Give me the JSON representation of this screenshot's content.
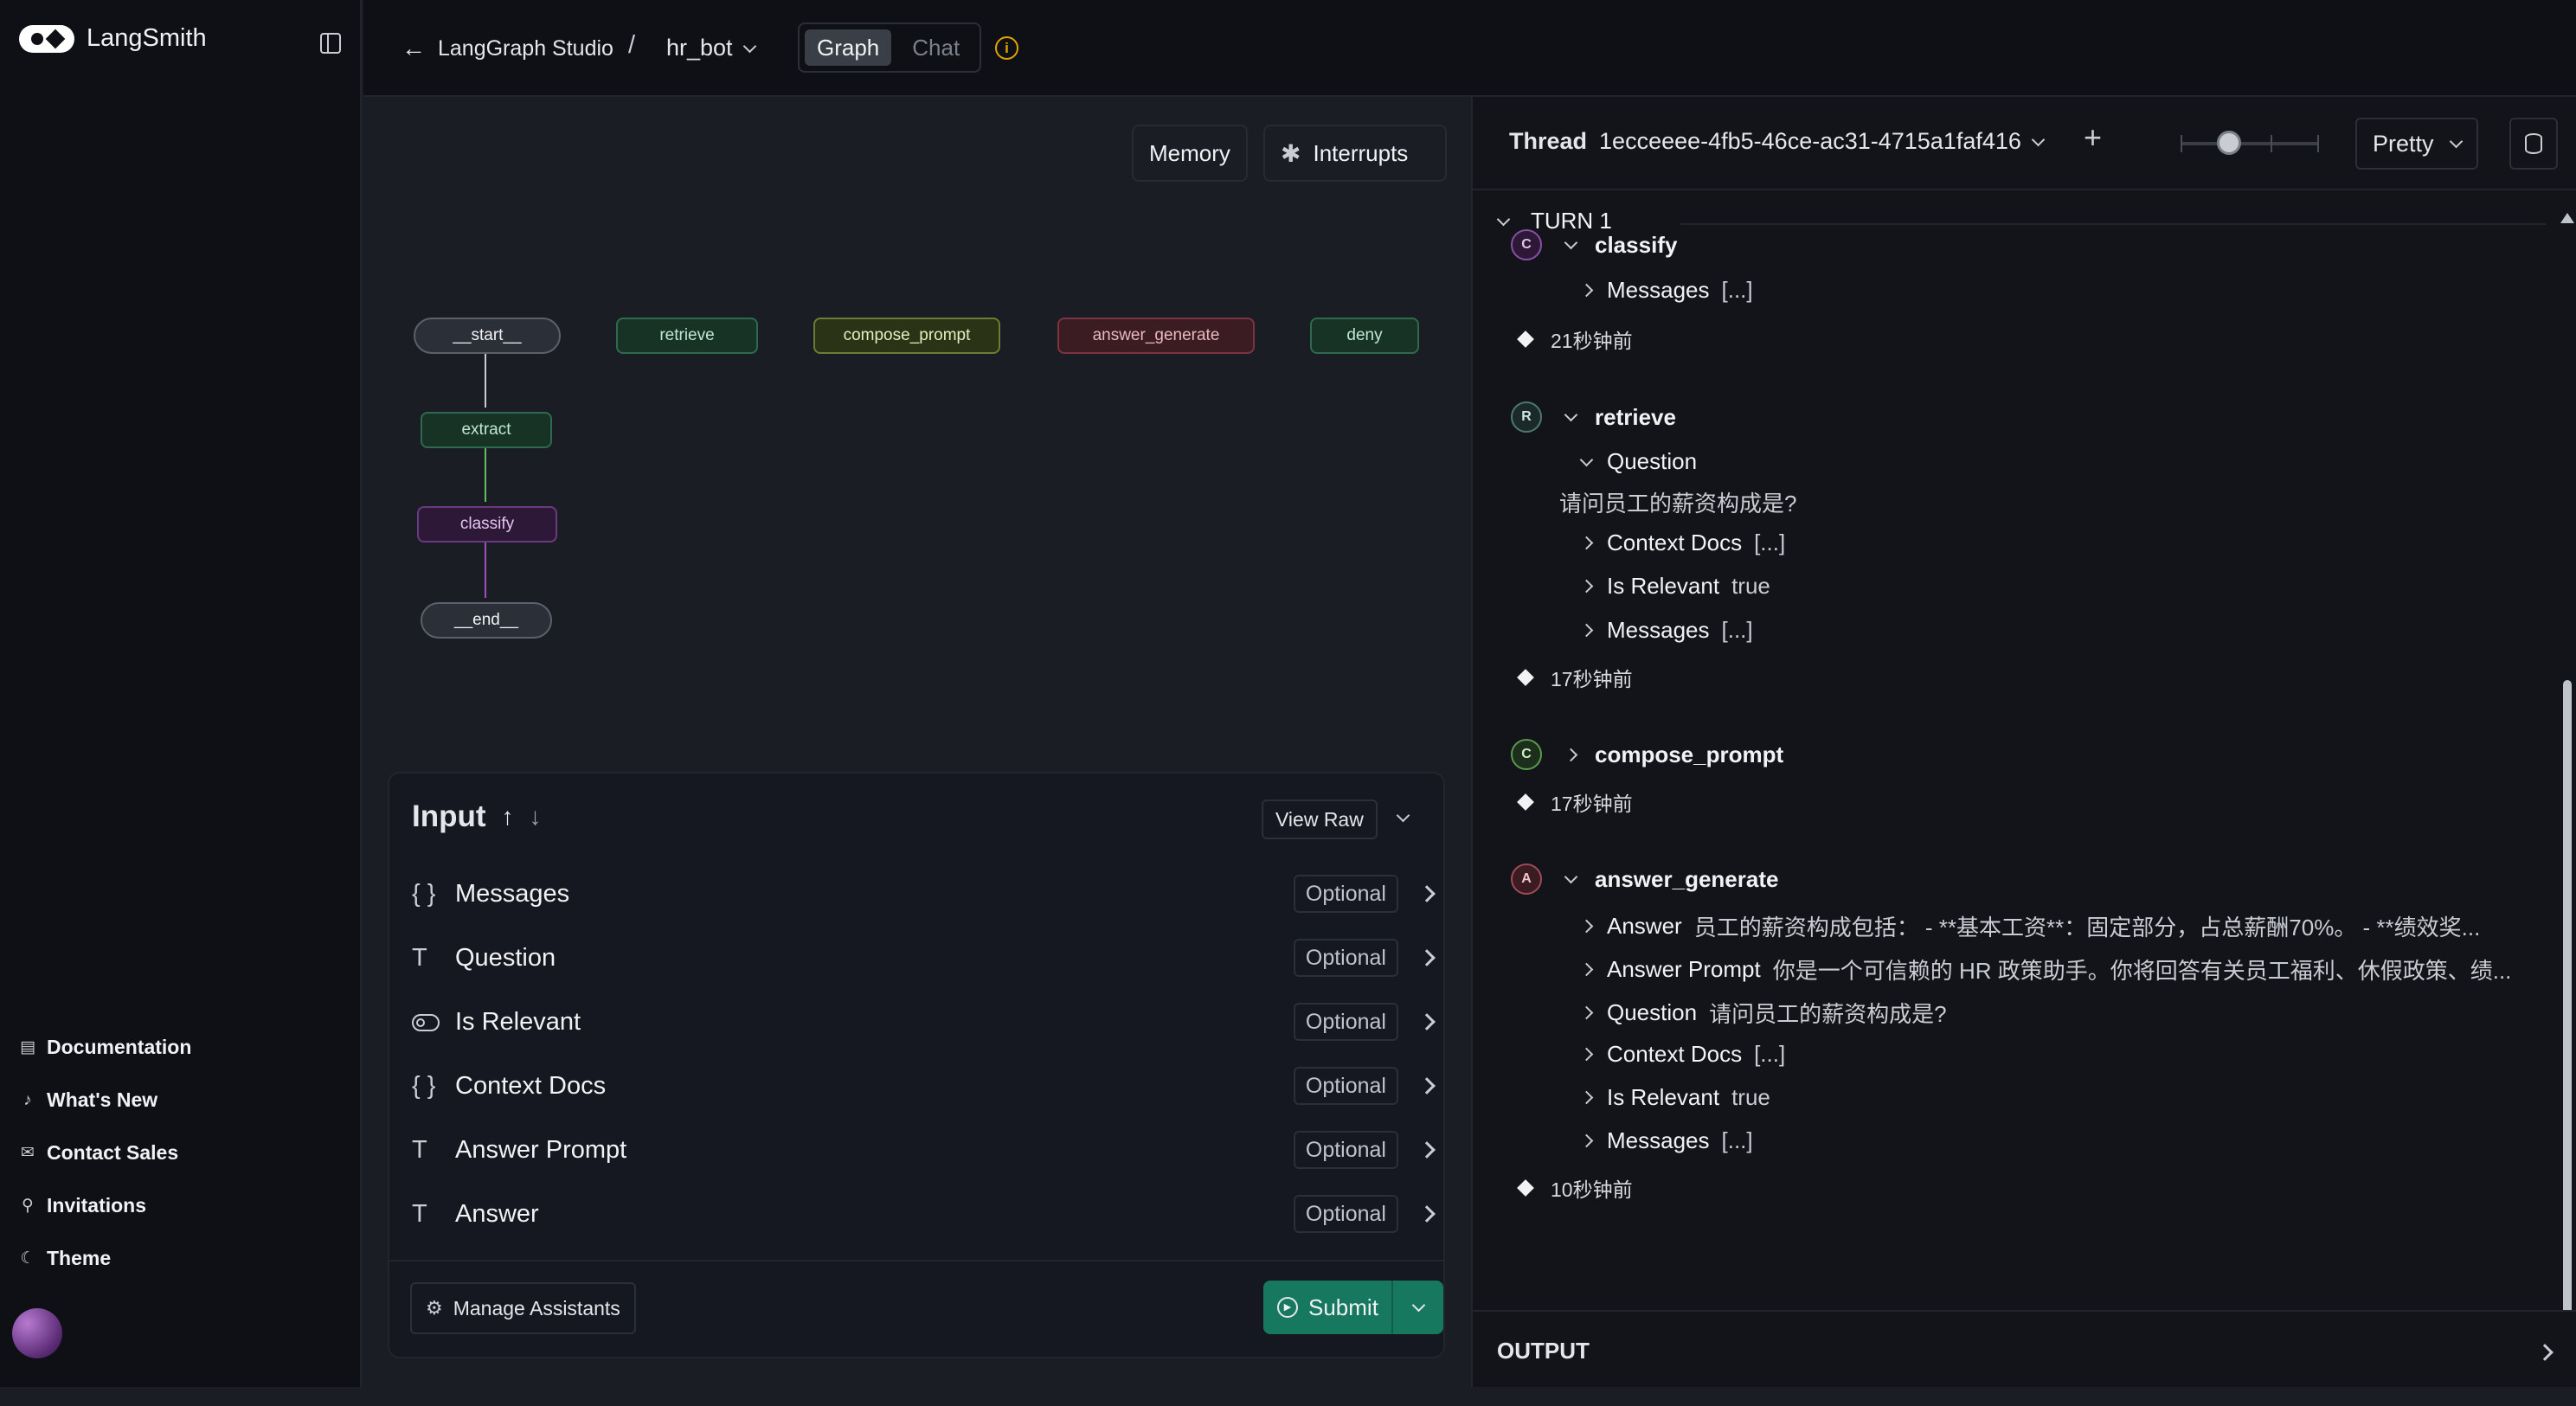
{
  "brand": {
    "name": "LangSmith"
  },
  "sidebar": {
    "links": [
      {
        "label": "Documentation",
        "icon": "doc-icon"
      },
      {
        "label": "What's New",
        "icon": "bell-icon"
      },
      {
        "label": "Contact Sales",
        "icon": "mail-icon"
      },
      {
        "label": "Invitations",
        "icon": "user-plus-icon"
      },
      {
        "label": "Theme",
        "icon": "moon-icon"
      }
    ]
  },
  "topbar": {
    "back_label": "LangGraph Studio",
    "separator": "/",
    "project": "hr_bot",
    "tabs": [
      {
        "label": "Graph",
        "active": true
      },
      {
        "label": "Chat",
        "active": false
      }
    ],
    "info_icon": "i"
  },
  "graph": {
    "memory_label": "Memory",
    "interrupts_label": "Interrupts",
    "nodes": {
      "start": "__start__",
      "retrieve": "retrieve",
      "compose_prompt": "compose_prompt",
      "answer_generate": "answer_generate",
      "deny": "deny",
      "extract": "extract",
      "classify": "classify",
      "end": "__end__"
    }
  },
  "input": {
    "title": "Input",
    "view_raw": "View Raw",
    "fields": [
      {
        "icon": "{ }",
        "label": "Messages",
        "badge": "Optional"
      },
      {
        "icon": "T",
        "label": "Question",
        "badge": "Optional"
      },
      {
        "icon": "toggle",
        "label": "Is Relevant",
        "badge": "Optional"
      },
      {
        "icon": "{ }",
        "label": "Context Docs",
        "badge": "Optional"
      },
      {
        "icon": "T",
        "label": "Answer Prompt",
        "badge": "Optional"
      },
      {
        "icon": "T",
        "label": "Answer",
        "badge": "Optional"
      }
    ],
    "manage_assistants": "Manage Assistants",
    "submit": "Submit"
  },
  "thread": {
    "label": "Thread",
    "id": "1ecceeee-4fb5-46ce-ac31-4715a1faf416",
    "view_mode": "Pretty",
    "slider_position": 0.35
  },
  "trace": {
    "turn": "TURN 1",
    "steps": [
      {
        "badge": "C",
        "name": "classify",
        "rows": [
          {
            "key": "Messages",
            "value": "[...]"
          }
        ],
        "time": "21秒钟前"
      },
      {
        "badge": "R",
        "name": "retrieve",
        "question_key": "Question",
        "question_value": "请问员工的薪资构成是?",
        "rows": [
          {
            "key": "Context Docs",
            "value": "[...]"
          },
          {
            "key": "Is Relevant",
            "value": "true"
          },
          {
            "key": "Messages",
            "value": "[...]"
          }
        ],
        "time": "17秒钟前"
      },
      {
        "badge": "C",
        "name": "compose_prompt",
        "time": "17秒钟前"
      },
      {
        "badge": "A",
        "name": "answer_generate",
        "rows": [
          {
            "key": "Answer",
            "value": "员工的薪资构成包括： - **基本工资**：固定部分，占总薪酬70%。 - **绩效奖..."
          },
          {
            "key": "Answer Prompt",
            "value": "你是一个可信赖的 HR 政策助手。你将回答有关员工福利、休假政策、绩..."
          },
          {
            "key": "Question",
            "value": "请问员工的薪资构成是?"
          },
          {
            "key": "Context Docs",
            "value": "[...]"
          },
          {
            "key": "Is Relevant",
            "value": "true"
          },
          {
            "key": "Messages",
            "value": "[...]"
          }
        ],
        "time": "10秒钟前"
      }
    ]
  },
  "output": {
    "label": "OUTPUT"
  }
}
